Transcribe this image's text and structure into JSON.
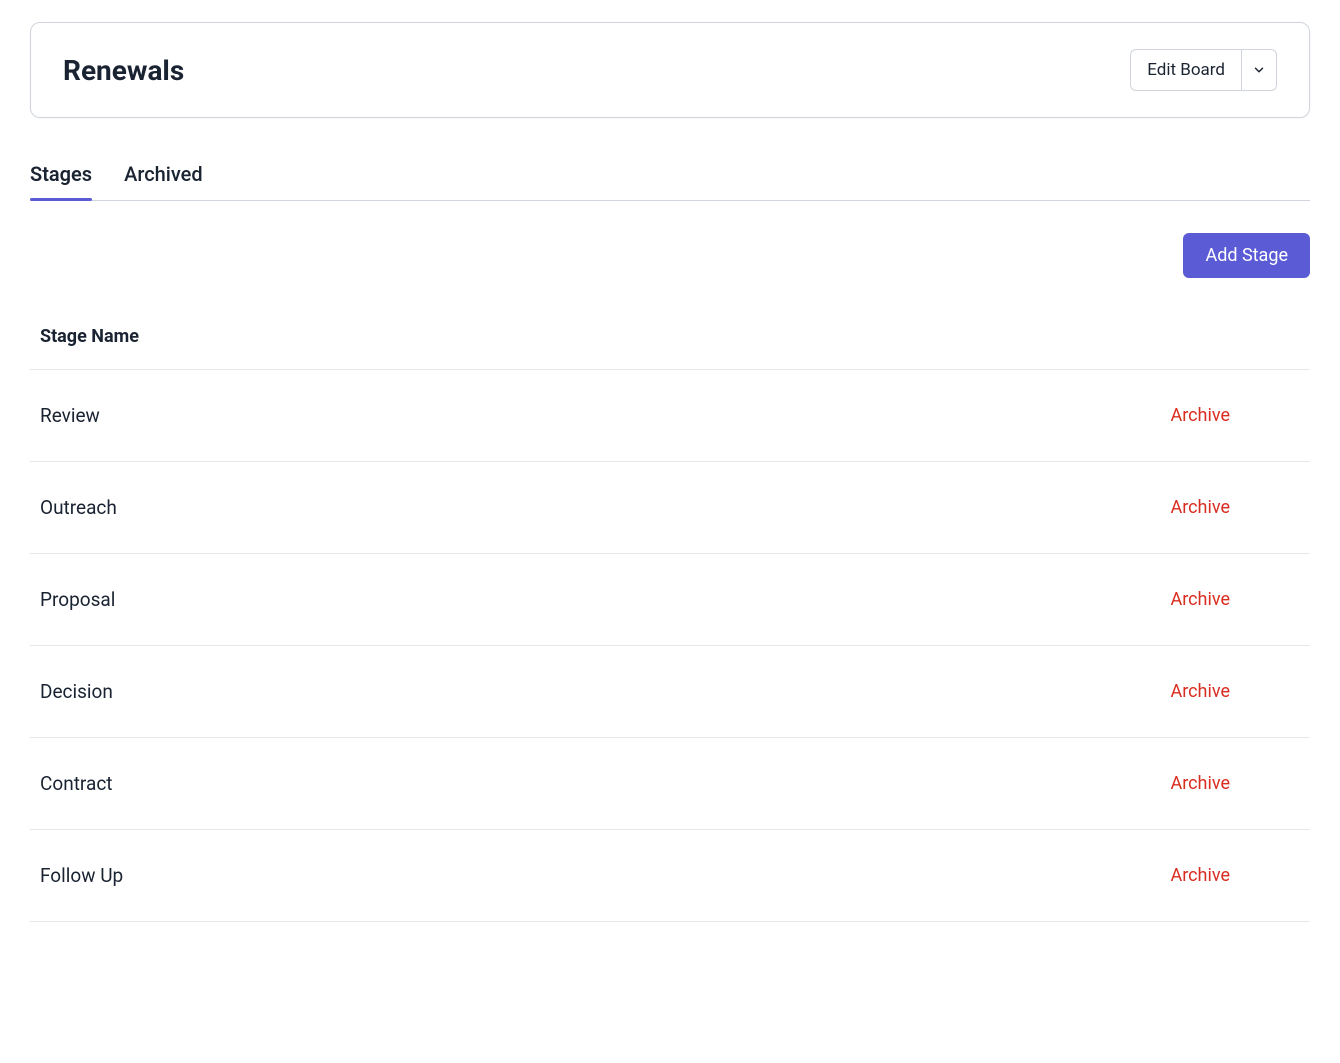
{
  "header": {
    "title": "Renewals",
    "editButton": "Edit Board"
  },
  "tabs": [
    {
      "label": "Stages",
      "active": true
    },
    {
      "label": "Archived",
      "active": false
    }
  ],
  "actions": {
    "addStage": "Add Stage"
  },
  "table": {
    "columnHeader": "Stage Name",
    "archiveLabel": "Archive",
    "rows": [
      {
        "name": "Review"
      },
      {
        "name": "Outreach"
      },
      {
        "name": "Proposal"
      },
      {
        "name": "Decision"
      },
      {
        "name": "Contract"
      },
      {
        "name": "Follow Up"
      }
    ]
  }
}
